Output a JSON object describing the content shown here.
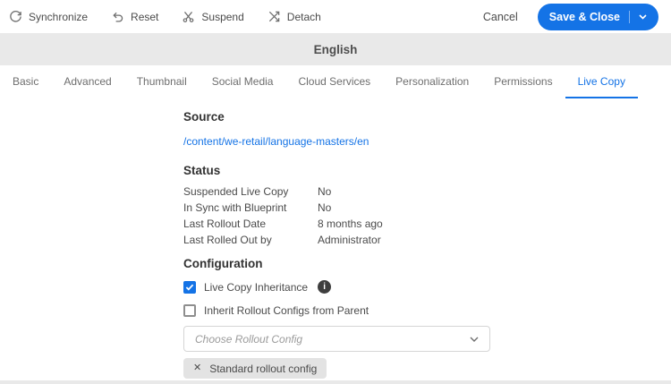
{
  "toolbar": {
    "actions": [
      {
        "label": "Synchronize"
      },
      {
        "label": "Reset"
      },
      {
        "label": "Suspend"
      },
      {
        "label": "Detach"
      }
    ],
    "cancel_label": "Cancel",
    "save_label": "Save & Close"
  },
  "header": {
    "title": "English"
  },
  "tabs": [
    {
      "label": "Basic"
    },
    {
      "label": "Advanced"
    },
    {
      "label": "Thumbnail"
    },
    {
      "label": "Social Media"
    },
    {
      "label": "Cloud Services"
    },
    {
      "label": "Personalization"
    },
    {
      "label": "Permissions"
    },
    {
      "label": "Live Copy"
    }
  ],
  "active_tab": "Live Copy",
  "source": {
    "heading": "Source",
    "path": "/content/we-retail/language-masters/en"
  },
  "status": {
    "heading": "Status",
    "rows": [
      {
        "label": "Suspended Live Copy",
        "value": "No"
      },
      {
        "label": "In Sync with Blueprint",
        "value": "No"
      },
      {
        "label": "Last Rollout Date",
        "value": "8 months ago"
      },
      {
        "label": "Last Rolled Out by",
        "value": "Administrator"
      }
    ]
  },
  "configuration": {
    "heading": "Configuration",
    "checkboxes": [
      {
        "label": "Live Copy Inheritance",
        "checked": true
      },
      {
        "label": "Inherit Rollout Configs from Parent",
        "checked": false
      }
    ],
    "rollout_select_placeholder": "Choose Rollout Config",
    "rollout_tag": "Standard rollout config"
  },
  "colors": {
    "accent": "#1473e6",
    "header_bg": "#e9e9e9",
    "tag_bg": "#e3e3e3"
  }
}
